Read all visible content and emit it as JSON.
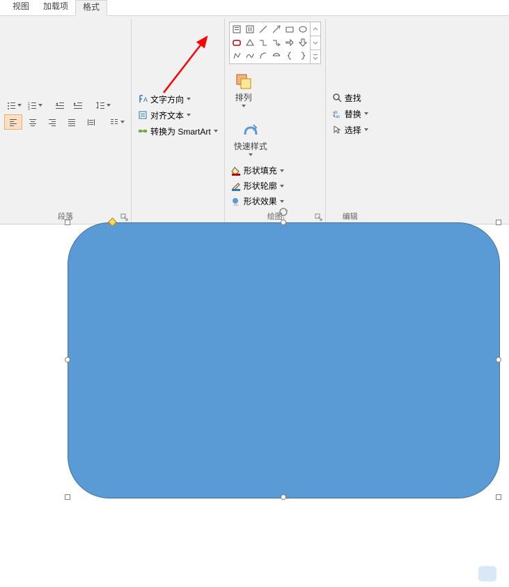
{
  "tabs": {
    "view": "视图",
    "addins": "加载项",
    "format": "格式"
  },
  "paragraph": {
    "text_direction": "文字方向",
    "align_text": "对齐文本",
    "convert_smartart": "转换为 SmartArt",
    "label": "段落"
  },
  "drawing": {
    "arrange": "排列",
    "quick_styles": "快速样式",
    "shape_fill": "形状填充",
    "shape_outline": "形状轮廓",
    "shape_effects": "形状效果",
    "label": "绘图"
  },
  "editing": {
    "find": "查找",
    "replace": "替换",
    "select": "选择",
    "label": "编辑"
  },
  "colors": {
    "shape_fill": "#5b9bd5",
    "shape_outline": "#41719c",
    "accent": "#ed7d31"
  }
}
